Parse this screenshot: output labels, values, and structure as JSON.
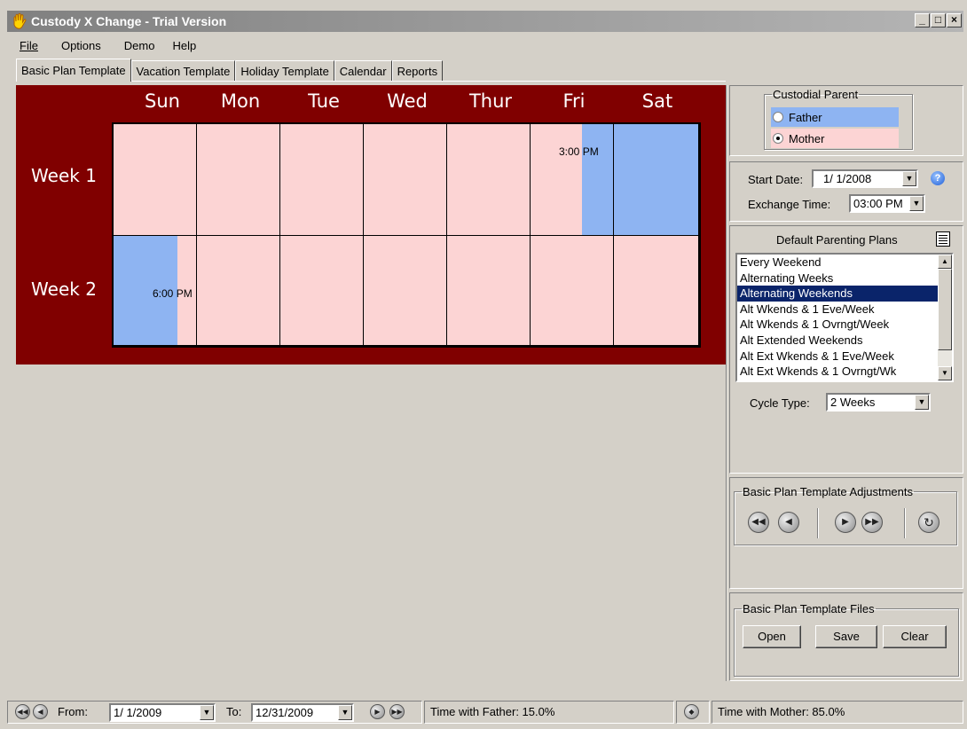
{
  "window": {
    "title": "Custody X Change - Trial Version",
    "controls": [
      "_",
      "□",
      "×"
    ]
  },
  "menu": [
    "File",
    "Options",
    "Demo",
    "Help"
  ],
  "tabs": [
    "Basic Plan Template",
    "Vacation Template",
    "Holiday Template",
    "Calendar",
    "Reports"
  ],
  "active_tab": "Basic Plan Template",
  "grid": {
    "days": [
      "Sun",
      "Mon",
      "Tue",
      "Wed",
      "Thur",
      "Fri",
      "Sat"
    ],
    "weeks": [
      "Week 1",
      "Week 2"
    ],
    "week1_fri_time": "3:00 PM",
    "week2_sun_time": "6:00 PM",
    "colors": {
      "father": "#8eb4f2",
      "mother": "#fcd4d4",
      "background": "#800000"
    }
  },
  "custodial_parent": {
    "legend": "Custodial Parent",
    "options": [
      "Father",
      "Mother"
    ],
    "selected": "Mother"
  },
  "start_date": {
    "label": "Start Date:",
    "value": "1/ 1/2008"
  },
  "exchange_time": {
    "label": "Exchange Time:",
    "value": "03:00 PM"
  },
  "plans": {
    "title": "Default Parenting Plans",
    "items": [
      "Every Weekend",
      "Alternating Weeks",
      "Alternating Weekends",
      "Alt Wkends & 1 Eve/Week",
      "Alt Wkends & 1 Ovrngt/Week",
      "Alt Extended Weekends",
      "Alt Ext Wkends & 1 Eve/Week",
      "Alt Ext Wkends & 1 Ovrngt/Wk"
    ],
    "selected": "Alternating Weekends"
  },
  "cycle_type": {
    "label": "Cycle Type:",
    "value": "2 Weeks"
  },
  "adjustments": {
    "legend": "Basic Plan Template Adjustments"
  },
  "files": {
    "legend": "Basic Plan Template Files",
    "open": "Open",
    "save": "Save",
    "clear": "Clear"
  },
  "status": {
    "from_label": "From:",
    "from_value": "1/ 1/2009",
    "to_label": "To:",
    "to_value": "12/31/2009",
    "father_time": "Time with Father: 15.0%",
    "mother_time": "Time with Mother: 85.0%"
  }
}
